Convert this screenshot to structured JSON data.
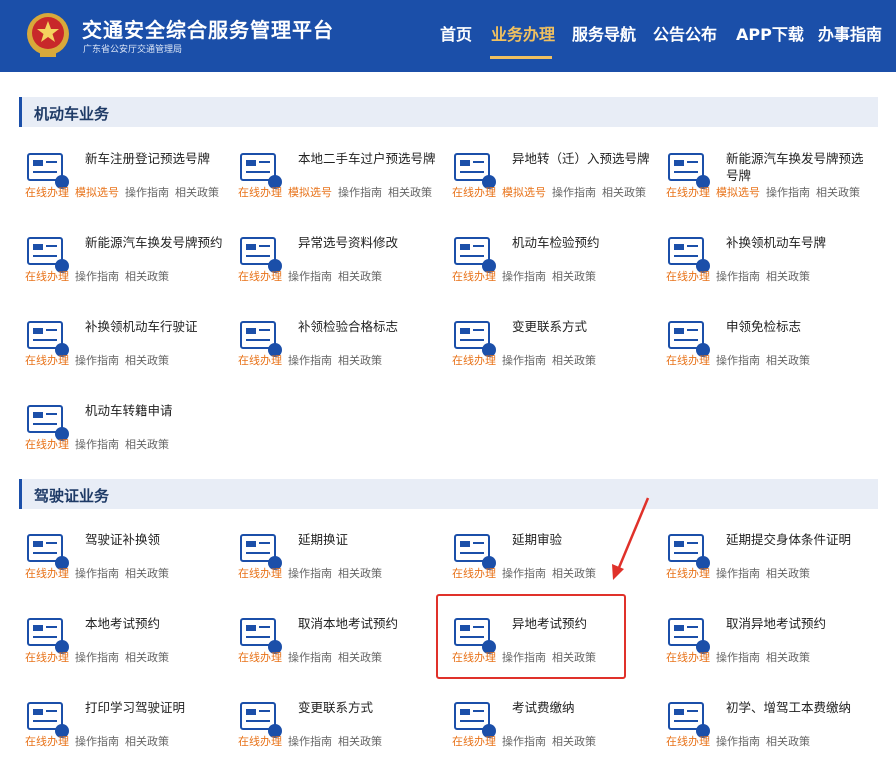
{
  "header": {
    "title": "交通安全综合服务管理平台",
    "subtitle": "广东省公安厅交通管理局",
    "nav": [
      "首页",
      "业务办理",
      "服务导航",
      "公告公布",
      "APP下载",
      "办事指南"
    ],
    "active_nav_index": 1,
    "accent_color": "#f0c060",
    "brand_color": "#1b4fa9"
  },
  "sections": [
    {
      "title": "机动车业务",
      "items": [
        {
          "name": "新车注册登记预选号牌",
          "links": [
            "在线办理",
            "模拟选号",
            "操作指南",
            "相关政策"
          ],
          "icon": "new-plate-icon"
        },
        {
          "name": "本地二手车过户预选号牌",
          "links": [
            "在线办理",
            "模拟选号",
            "操作指南",
            "相关政策"
          ],
          "icon": "car-transfer-icon"
        },
        {
          "name": "异地转（迁）入预选号牌",
          "links": [
            "在线办理",
            "模拟选号",
            "操作指南",
            "相关政策"
          ],
          "icon": "car-import-icon"
        },
        {
          "name": "新能源汽车换发号牌预选号牌",
          "links": [
            "在线办理",
            "模拟选号",
            "操作指南",
            "相关政策"
          ],
          "icon": "ev-plate-icon"
        },
        {
          "name": "新能源汽车换发号牌预约",
          "links": [
            "在线办理",
            "操作指南",
            "相关政策"
          ],
          "icon": "ev-plate-booking-icon"
        },
        {
          "name": "异常选号资料修改",
          "links": [
            "在线办理",
            "操作指南",
            "相关政策"
          ],
          "icon": "plate-edit-icon"
        },
        {
          "name": "机动车检验预约",
          "links": [
            "在线办理",
            "操作指南",
            "相关政策"
          ],
          "icon": "inspection-booking-icon"
        },
        {
          "name": "补换领机动车号牌",
          "links": [
            "在线办理",
            "操作指南",
            "相关政策"
          ],
          "icon": "plate-replace-icon"
        },
        {
          "name": "补换领机动车行驶证",
          "links": [
            "在线办理",
            "操作指南",
            "相关政策"
          ],
          "icon": "license-replace-icon"
        },
        {
          "name": "补领检验合格标志",
          "links": [
            "在线办理",
            "操作指南",
            "相关政策"
          ],
          "icon": "inspection-mark-icon"
        },
        {
          "name": "变更联系方式",
          "links": [
            "在线办理",
            "操作指南",
            "相关政策"
          ],
          "icon": "contact-change-icon"
        },
        {
          "name": "申领免检标志",
          "links": [
            "在线办理",
            "操作指南",
            "相关政策"
          ],
          "icon": "exempt-mark-icon"
        },
        {
          "name": "机动车转籍申请",
          "links": [
            "在线办理",
            "操作指南",
            "相关政策"
          ],
          "icon": "vehicle-transfer-icon"
        }
      ]
    },
    {
      "title": "驾驶证业务",
      "items": [
        {
          "name": "驾驶证补换领",
          "links": [
            "在线办理",
            "操作指南",
            "相关政策"
          ],
          "icon": "driver-license-icon"
        },
        {
          "name": "延期换证",
          "links": [
            "在线办理",
            "操作指南",
            "相关政策"
          ],
          "icon": "renew-license-icon"
        },
        {
          "name": "延期审验",
          "links": [
            "在线办理",
            "操作指南",
            "相关政策"
          ],
          "icon": "audit-delay-icon"
        },
        {
          "name": "延期提交身体条件证明",
          "links": [
            "在线办理",
            "操作指南",
            "相关政策"
          ],
          "icon": "health-proof-icon"
        },
        {
          "name": "本地考试预约",
          "links": [
            "在线办理",
            "操作指南",
            "相关政策"
          ],
          "icon": "exam-booking-icon"
        },
        {
          "name": "取消本地考试预约",
          "links": [
            "在线办理",
            "操作指南",
            "相关政策"
          ],
          "icon": "cancel-exam-icon"
        },
        {
          "name": "异地考试预约",
          "links": [
            "在线办理",
            "操作指南",
            "相关政策"
          ],
          "icon": "remote-exam-icon"
        },
        {
          "name": "取消异地考试预约",
          "links": [
            "在线办理",
            "操作指南",
            "相关政策"
          ],
          "icon": "cancel-remote-exam-icon"
        },
        {
          "name": "打印学习驾驶证明",
          "links": [
            "在线办理",
            "操作指南",
            "相关政策"
          ],
          "icon": "print-proof-icon"
        },
        {
          "name": "变更联系方式",
          "links": [
            "在线办理",
            "操作指南",
            "相关政策"
          ],
          "icon": "contact-change-icon"
        },
        {
          "name": "考试费缴纳",
          "links": [
            "在线办理",
            "操作指南",
            "相关政策"
          ],
          "icon": "exam-fee-icon"
        },
        {
          "name": "初学、增驾工本费缴纳",
          "links": [
            "在线办理",
            "操作指南",
            "相关政策"
          ],
          "icon": "cost-fee-icon"
        }
      ]
    }
  ]
}
